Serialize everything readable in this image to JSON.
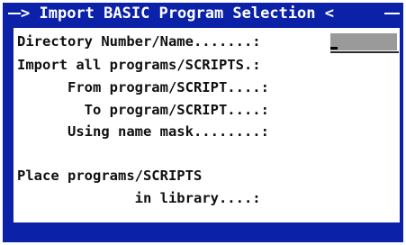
{
  "dialog": {
    "title": "Import BASIC Program Selection",
    "title_prefix": "> ",
    "title_suffix": " <"
  },
  "fields": {
    "directory": {
      "label": "Directory Number/Name.......:",
      "value": ""
    },
    "import_all": {
      "label": "Import all programs/SCRIPTS.:"
    },
    "from_program": {
      "label": "      From program/SCRIPT....:"
    },
    "to_program": {
      "label": "        To program/SCRIPT....:"
    },
    "name_mask": {
      "label": "      Using name mask........:"
    },
    "place_programs": {
      "label": "Place programs/SCRIPTS"
    },
    "in_library": {
      "label": "              in library....:"
    }
  },
  "colors": {
    "frame": "#0b22a8",
    "panel": "#ffffff",
    "input_highlight": "#9a9a9a",
    "text": "#101010"
  }
}
